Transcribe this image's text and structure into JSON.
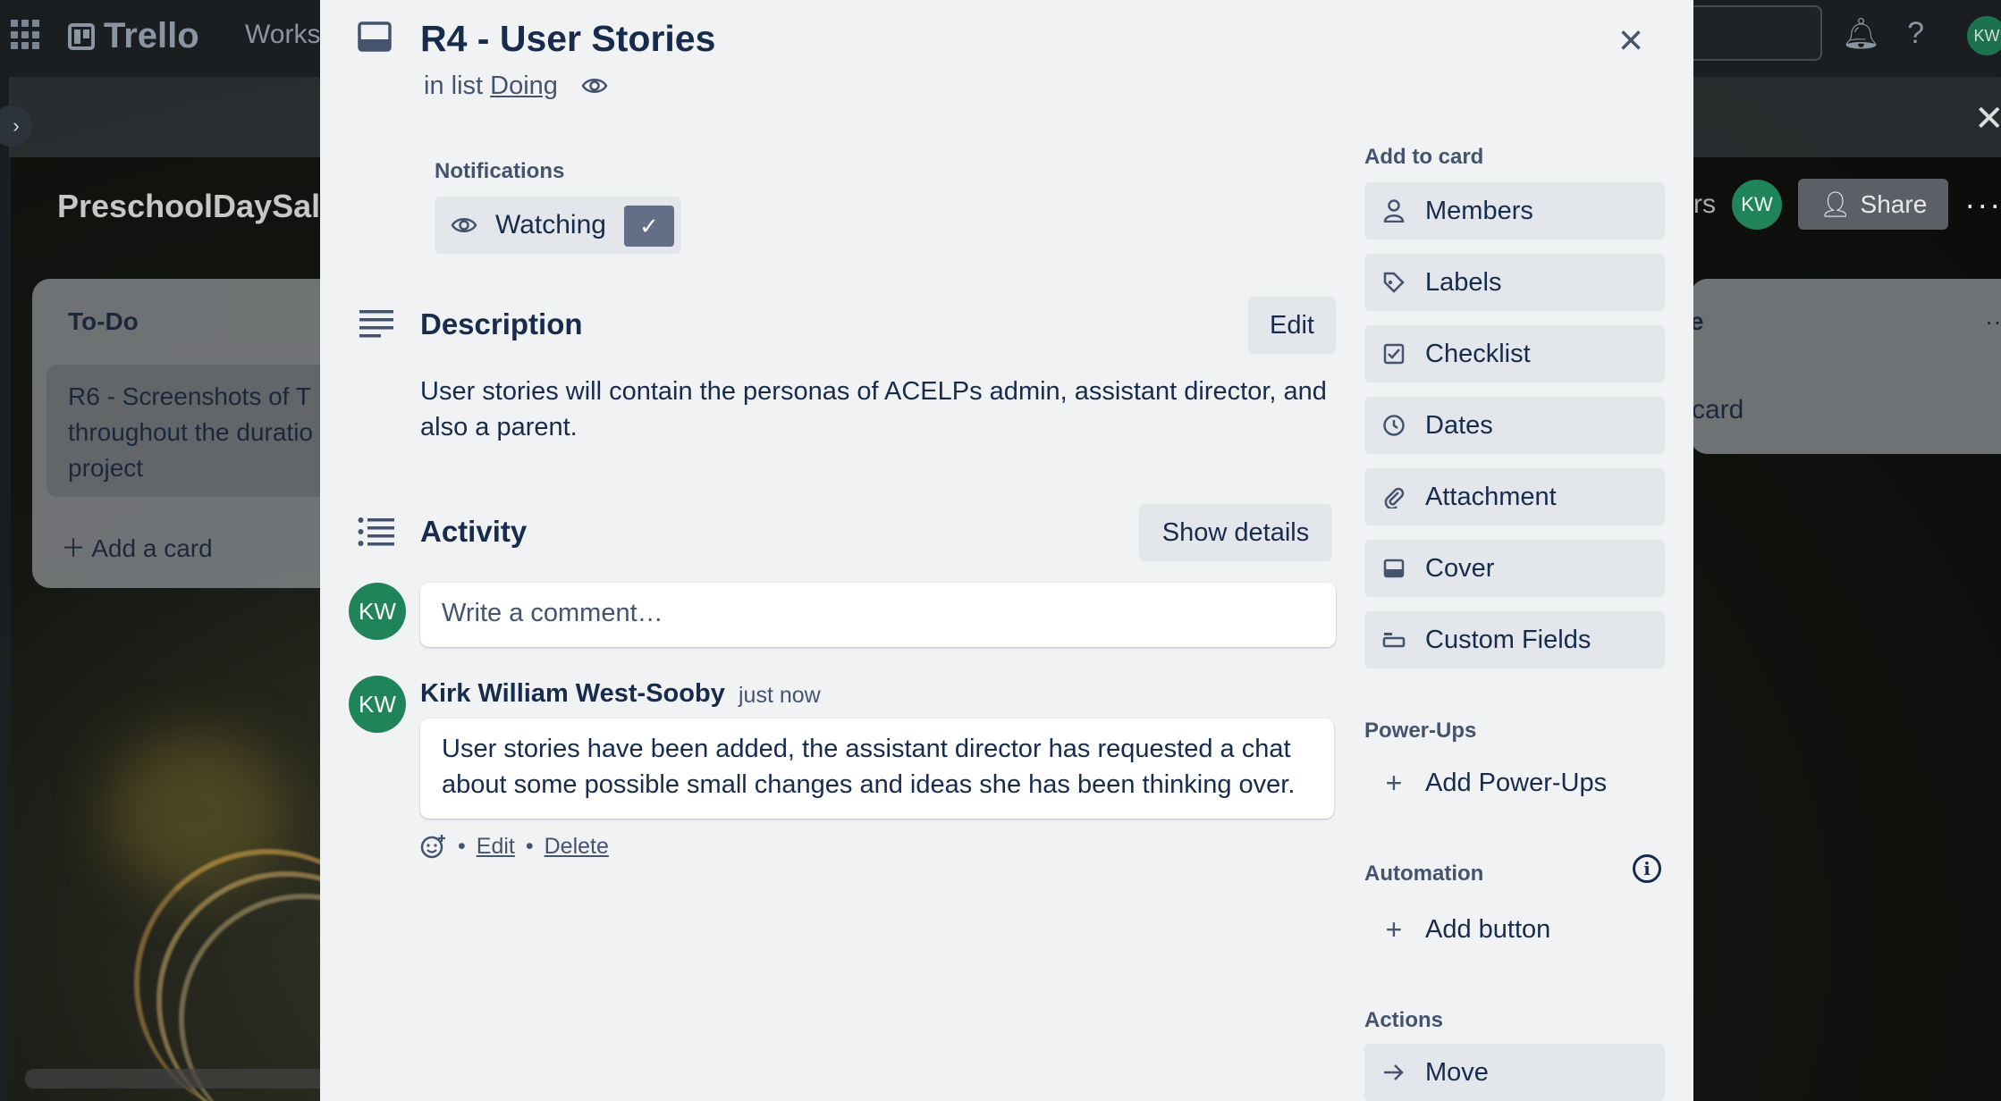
{
  "topbar": {
    "app_name": "Trello",
    "workspaces_label": "Works",
    "avatar_initials": "KW"
  },
  "board": {
    "title": "PreschoolDaySale",
    "right_header_fragment": "rs",
    "avatar_initials": "KW",
    "share_label": "Share",
    "more_label": "···",
    "lists": {
      "todo": {
        "title": "To-Do",
        "card_text": "R6 - Screenshots of T throughout the duratio project",
        "add_card": "Add a card"
      },
      "right": {
        "title_fragment": "e",
        "add_card_fragment": "card",
        "dots": "···"
      }
    }
  },
  "card": {
    "title": "R4 - User Stories",
    "in_list_prefix": "in list",
    "list_name": "Doing",
    "close_label": "×",
    "notifications": {
      "label": "Notifications",
      "watching_label": "Watching",
      "check": "✓"
    },
    "description": {
      "title": "Description",
      "edit_label": "Edit",
      "text": "User stories will contain the personas of ACELPs admin, assistant director, and also a parent."
    },
    "activity": {
      "title": "Activity",
      "show_details_label": "Show details",
      "comment_placeholder": "Write a comment…",
      "user_initials": "KW",
      "comments": [
        {
          "author": "Kirk William West-Sooby",
          "initials": "KW",
          "time": "just now",
          "text": "User stories have been added, the assistant director has requested a chat about some possible small changes and ideas she has been thinking over.",
          "edit_label": "Edit",
          "delete_label": "Delete",
          "separator": "•"
        }
      ]
    }
  },
  "sidebar": {
    "add_to_card_label": "Add to card",
    "add_to_card": [
      {
        "label": "Members",
        "icon": "person-icon"
      },
      {
        "label": "Labels",
        "icon": "tag-icon"
      },
      {
        "label": "Checklist",
        "icon": "checkbox-icon"
      },
      {
        "label": "Dates",
        "icon": "clock-icon"
      },
      {
        "label": "Attachment",
        "icon": "paperclip-icon"
      },
      {
        "label": "Cover",
        "icon": "cover-icon"
      },
      {
        "label": "Custom Fields",
        "icon": "custom-fields-icon"
      }
    ],
    "powerups_label": "Power-Ups",
    "add_powerups": "Add Power-Ups",
    "automation_label": "Automation",
    "info_glyph": "i",
    "add_button": "Add button",
    "actions_label": "Actions",
    "move": "Move"
  },
  "colors": {
    "modal_bg": "#f1f2f4",
    "button_bg": "#e3e6ea",
    "text": "#172b4d",
    "subtle_text": "#44546f",
    "avatar_green": "#1f845a",
    "watch_check_bg": "#626f86"
  }
}
